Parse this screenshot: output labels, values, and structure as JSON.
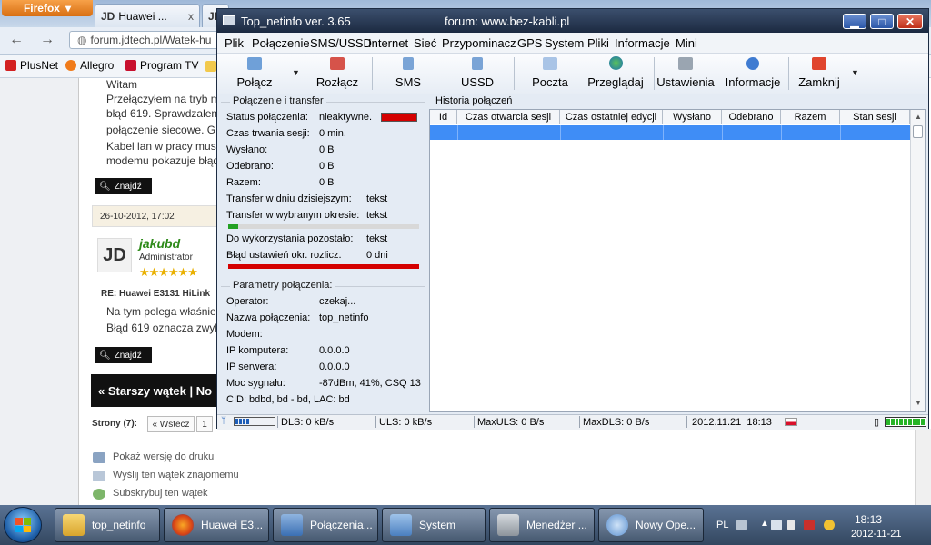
{
  "firefox": {
    "menu_label": "Firefox",
    "tab1": "Huawei ...",
    "tab1_close": "x",
    "tab2": "JD",
    "url": "forum.jdtech.pl/Watek-hu",
    "bookmarks": [
      "PlusNet",
      "Allegro",
      "Program TV"
    ]
  },
  "forum_page": {
    "greeting": "Witam",
    "lines": [
      "Przełączyłem na tryb m",
      "błąd 619. Sprawdzałen",
      "połączenie siecowe. G",
      "Kabel lan w pracy mus",
      "modemu pokazuje błąd"
    ],
    "search_btn": "Znajdź",
    "post_date": "26-10-2012, 17:02",
    "avatar_text": "JD",
    "username": "jakubd",
    "role": "Administrator",
    "stars": "★★★★★★",
    "reply_title": "RE: Huawei E3131 HiLink",
    "reply_lines": [
      "Na tym polega właśnie",
      "Błąd 619 oznacza zwyk"
    ],
    "search_btn2": "Znajdź",
    "older_thread": "« Starszy wątek | No",
    "pages_label": "Strony (7):",
    "prev_btn": "« Wstecz",
    "page1": "1",
    "tools": [
      "Pokaż wersję do druku",
      "Wyślij ten wątek znajomemu",
      "Subskrybuj ten wątek"
    ]
  },
  "app": {
    "title": "Top_netinfo ver. 3.65",
    "forum": "forum: www.bez-kabli.pl",
    "menu": [
      "Plik",
      "Połączenie",
      "SMS/USSD",
      "Internet",
      "Sieć",
      "Przypominacz",
      "GPS",
      "System",
      "Pliki",
      "Informacje",
      "Mini"
    ],
    "toolbar": [
      "Połącz",
      "Rozłącz",
      "SMS",
      "USSD",
      "Poczta",
      "Przeglądaj",
      "Ustawienia",
      "Informacje",
      "Zamknij"
    ],
    "connection_group_title": "Połączenie i transfer",
    "connection": {
      "status_label": "Status połączenia:",
      "status_value": "nieaktywne.",
      "duration_label": "Czas trwania sesji:",
      "duration_value": "0 min.",
      "sent_label": "Wysłano:",
      "sent_value": "0 B",
      "received_label": "Odebrano:",
      "received_value": "0 B",
      "total_label": "Razem:",
      "total_value": "0 B",
      "today_label": "Transfer w dniu dzisiejszym:",
      "today_value": "tekst",
      "period_label": "Transfer w wybranym okresie:",
      "period_value": "tekst",
      "period_progress": 0.05,
      "remaining_label": "Do wykorzystania pozostało:",
      "remaining_value": "tekst",
      "error_label": "Błąd ustawień okr. rozlicz.",
      "error_value": "0 dni",
      "error_progress": 1.0
    },
    "params_group_title": "Parametry połączenia:",
    "params": {
      "operator_label": "Operator:",
      "operator_value": "czekaj...",
      "conn_name_label": "Nazwa połączenia:",
      "conn_name_value": "top_netinfo",
      "modem_label": "Modem:",
      "modem_value": "",
      "ip_pc_label": "IP komputera:",
      "ip_pc_value": "0.0.0.0",
      "ip_srv_label": "IP serwera:",
      "ip_srv_value": "0.0.0.0",
      "signal_label": "Moc sygnału:",
      "signal_value": "-87dBm, 41%, CSQ 13",
      "cid": "CID: bdbd, bd - bd, LAC: bd"
    },
    "history_title": "Historia połączeń",
    "history_columns": [
      "Id",
      "Czas otwarcia sesji",
      "Czas ostatniej edycji",
      "Wysłano",
      "Odebrano",
      "Razem",
      "Stan sesji"
    ],
    "statusbar": {
      "dls": "DLS: 0 kB/s",
      "uls": "ULS: 0 kB/s",
      "maxuls": "MaxULS: 0 B/s",
      "maxdls": "MaxDLS: 0 B/s",
      "datetime": "2012.11.21  18:13",
      "signal_level": 0.41,
      "battery_level": 1.0
    }
  },
  "taskbar": {
    "items": [
      "top_netinfo",
      "Huawei E3...",
      "Połączenia...",
      "System",
      "Menedżer ...",
      "Nowy Ope..."
    ],
    "lang": "PL",
    "time": "18:13",
    "date": "2012-11-21"
  },
  "colors": {
    "status_red": "#d40000",
    "progress_green": "#23a023",
    "selection_blue": "#3f8df6"
  }
}
